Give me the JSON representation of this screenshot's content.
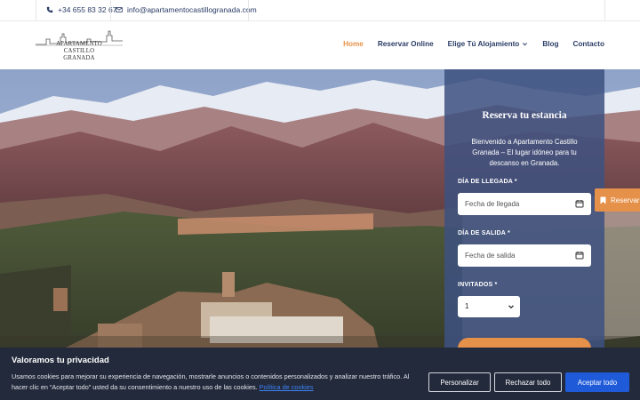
{
  "topbar": {
    "phone": "+34 655 83 32 67",
    "email": "info@apartamentocastillogranada.com",
    "phone_icon": "phone-icon",
    "email_icon": "mail-icon"
  },
  "header": {
    "logo_lines": [
      "APARTAMENTO",
      "CASTILLO",
      "GRANADA"
    ],
    "nav": [
      {
        "label": "Home",
        "active": true
      },
      {
        "label": "Reservar Online",
        "active": false
      },
      {
        "label": "Elige Tú Alojamiento",
        "active": false,
        "dropdown": true
      },
      {
        "label": "Blog",
        "active": false
      },
      {
        "label": "Contacto",
        "active": false
      }
    ]
  },
  "booking": {
    "title": "Reserva tu estancia",
    "intro": "Bienvenido a Apartamento Castillo Granada – El lugar idóneo para tu descanso en Granada.",
    "arrival_label": "DÍA DE LLEGADA *",
    "arrival_placeholder": "Fecha de llegada",
    "departure_label": "DÍA DE SALIDA *",
    "departure_placeholder": "Fecha de salida",
    "guests_label": "INVITADOS *",
    "guests_value": "1"
  },
  "side_tab": {
    "label": "Reservar",
    "icon": "bookmark-icon"
  },
  "cookie": {
    "title": "Valoramos tu privacidad",
    "text": "Usamos cookies para mejorar su experiencia de navegación, mostrarle anuncios o contenidos personalizados y analizar nuestro tráfico. Al hacer clic en “Aceptar todo” usted da su consentimiento a nuestro uso de las cookies.",
    "policy_link": "Política de cookies",
    "btn_customize": "Personalizar",
    "btn_reject": "Rechazar todo",
    "btn_accept": "Aceptar todo"
  },
  "colors": {
    "accent": "#e6914a",
    "navy": "#2a3c66",
    "panel": "#3e5280",
    "cookie_bg": "#232a3b",
    "accept": "#1f5bd9"
  }
}
